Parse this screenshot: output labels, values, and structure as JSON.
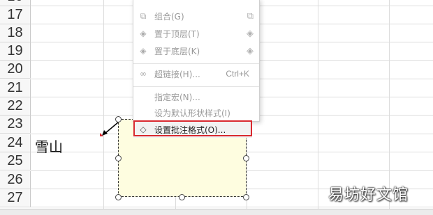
{
  "rows": [
    "16",
    "17",
    "18",
    "19",
    "20",
    "21",
    "22",
    "23",
    "24",
    "25",
    "26",
    "27"
  ],
  "cell_text": "雪山",
  "menu": {
    "items": [
      {
        "label": "组合(G)",
        "shortcut": "",
        "icon": "group-icon",
        "right_icon": "group-options-icon"
      },
      {
        "label": "置于顶层(T)",
        "shortcut": "",
        "icon": "bring-to-front-icon",
        "right_icon": "bring-to-front-options-icon"
      },
      {
        "label": "置于底层(K)",
        "shortcut": "",
        "icon": "send-to-back-icon",
        "right_icon": "send-to-back-options-icon"
      },
      {
        "label": "超链接(H)...",
        "shortcut": "Ctrl+K",
        "icon": "hyperlink-icon",
        "right_icon": ""
      },
      {
        "label": "指定宏(N)...",
        "shortcut": "",
        "icon": "",
        "right_icon": ""
      },
      {
        "label": "设为默认形状样式(I)",
        "shortcut": "",
        "icon": "",
        "right_icon": ""
      },
      {
        "label": "设置批注格式(O)...",
        "shortcut": "",
        "icon": "format-comment-icon",
        "right_icon": ""
      }
    ]
  },
  "watermark": "易坊好文馆",
  "colors": {
    "highlight": "#d9292f",
    "comment_fill": "#fefde0"
  }
}
